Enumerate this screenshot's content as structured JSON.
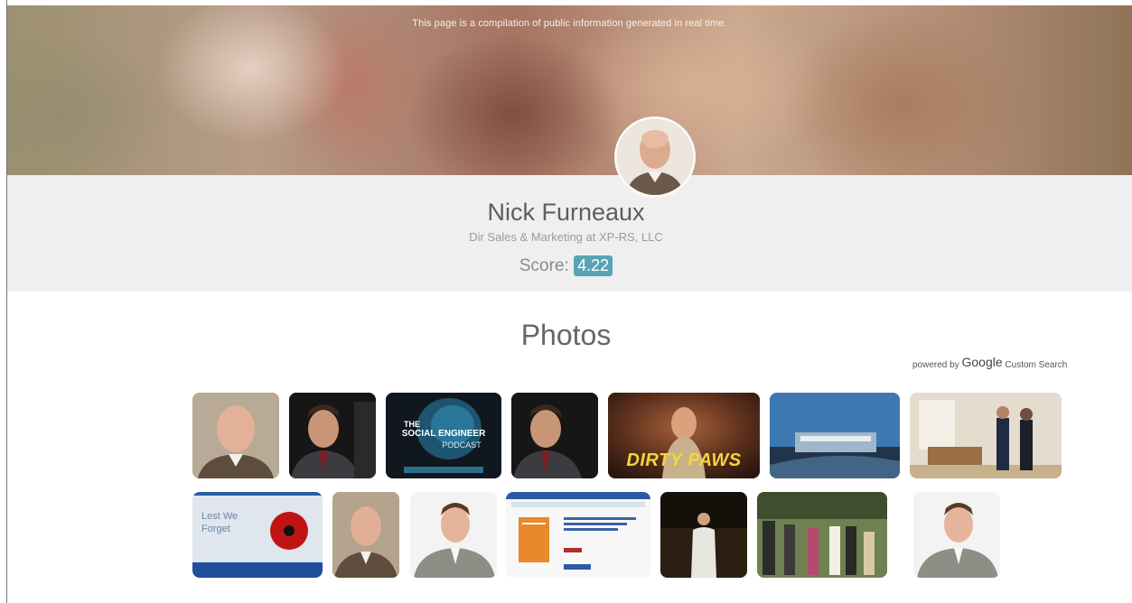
{
  "banner": {
    "note": "This page is a compilation of public information generated in real time."
  },
  "profile": {
    "name": "Nick Furneaux",
    "title": "Dir Sales & Marketing at XP-RS, LLC",
    "score_label": "Score:",
    "score_value": "4.22"
  },
  "photos": {
    "heading": "Photos",
    "powered_by": "powered by",
    "google": "Google",
    "custom_search": "Custom Search"
  },
  "thumbnails": {
    "podcast_line1": "THE",
    "podcast_line2": "SOCIAL ENGINEER",
    "podcast_line3": "PODCAST",
    "dirty_paws": "DIRTY PAWS",
    "lest_we_forget": "Lest We Forget"
  },
  "colors": {
    "score_badge": "#58a3b6",
    "profile_band": "#efefef"
  }
}
